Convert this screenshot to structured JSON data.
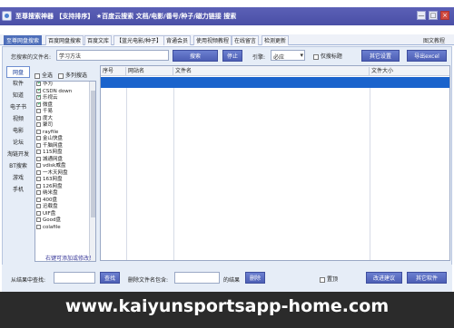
{
  "window": {
    "title": "至尊搜索神器 【支持排序】 ★百度云搜索 文档/电影/番号/种子/磁力链接 搜索",
    "min_glyph": "—",
    "max_glyph": "□",
    "close_glyph": "×"
  },
  "tabs": [
    {
      "label": "至尊网盘搜索",
      "active": true
    },
    {
      "label": "百度网盘搜索"
    },
    {
      "label": "百度文库"
    },
    {
      "label": "【蓝光电影/种子】"
    },
    {
      "label": "背通会员"
    },
    {
      "label": "使用视频教程"
    },
    {
      "label": "在线留言"
    },
    {
      "label": "检测更新"
    }
  ],
  "help_link": "图文教程",
  "search": {
    "label": "您搜索的文件名:",
    "value": "学习方法",
    "search_button": "搜索",
    "stop_button": "停止",
    "engine_label": "引擎:",
    "engine_value": "必应",
    "exact_title_label": "仅搜标题",
    "other_settings_button": "其它设置",
    "export_button": "导出excel"
  },
  "categories": [
    "网盘",
    "软件",
    "知道",
    "电子书",
    "视频",
    "电影",
    "论坛",
    "淘链开发",
    "BT搜索",
    "游戏",
    "手机"
  ],
  "site_panel": {
    "select_all": "全选",
    "multi_select": "多列搜选",
    "sites": [
      {
        "name": "华为",
        "checked": true
      },
      {
        "name": "CSDN down",
        "checked": true
      },
      {
        "name": "乐视云",
        "checked": true
      },
      {
        "name": "微盘",
        "checked": true
      },
      {
        "name": "千易",
        "checked": false
      },
      {
        "name": "度大",
        "checked": false
      },
      {
        "name": "聚司",
        "checked": false
      },
      {
        "name": "rayfile",
        "checked": false
      },
      {
        "name": "金山快盘",
        "checked": false
      },
      {
        "name": "千脑网盘",
        "checked": false
      },
      {
        "name": "115网盘",
        "checked": false
      },
      {
        "name": "城通网盘",
        "checked": false
      },
      {
        "name": "vdisk威盘",
        "checked": false
      },
      {
        "name": "一木天网盘",
        "checked": false
      },
      {
        "name": "163网盘",
        "checked": false
      },
      {
        "name": "126网盘",
        "checked": false
      },
      {
        "name": "纳米盘",
        "checked": false
      },
      {
        "name": "400盘",
        "checked": false
      },
      {
        "name": "迅载盘",
        "checked": false
      },
      {
        "name": "UIF盘",
        "checked": false
      },
      {
        "name": "Good盘",
        "checked": false
      },
      {
        "name": "colafile",
        "checked": false
      }
    ],
    "add_hint": "右键可添加或修改！"
  },
  "results": {
    "columns": [
      "序号",
      "网站名",
      "文件名",
      "文件大小"
    ]
  },
  "bottom": {
    "in_result_label": "从结果中查找:",
    "find_button": "查找",
    "delete_label": "删除文件名包含:",
    "result_suffix": "的结果",
    "delete_button": "删除",
    "ontop_label": "置顶",
    "suggest_button": "改进建议",
    "other_software_button": "其它软件"
  },
  "banner_text": "www.kaiyunsportsapp-home.com"
}
